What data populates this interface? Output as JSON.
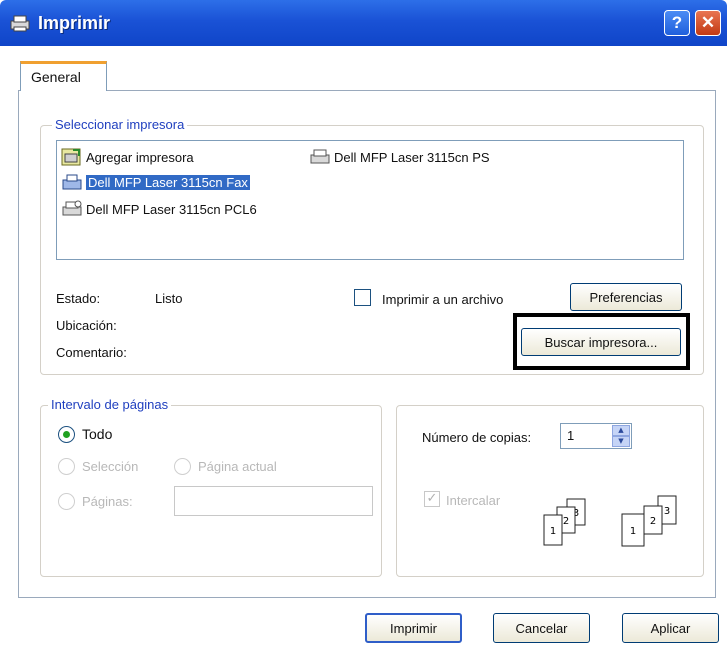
{
  "window": {
    "title": "Imprimir",
    "help_label": "?",
    "close_label": "✕"
  },
  "tabs": [
    {
      "label": "General"
    }
  ],
  "select_printer": {
    "legend": "Seleccionar impresora",
    "printers": [
      {
        "label": "Agregar impresora",
        "icon": "add-printer-icon"
      },
      {
        "label": "Dell MFP Laser 3115cn PS",
        "icon": "printer-icon"
      },
      {
        "label": "Dell MFP Laser 3115cn Fax",
        "icon": "fax-icon",
        "selected": true
      },
      {
        "label": "Dell MFP Laser 3115cn PCL6",
        "icon": "printer-icon"
      }
    ],
    "status_label": "Estado:",
    "status_value": "Listo",
    "location_label": "Ubicación:",
    "comment_label": "Comentario:",
    "print_to_file_label": "Imprimir a un archivo",
    "preferences_button": "Preferencias",
    "find_printer_button": "Buscar impresora..."
  },
  "page_range": {
    "legend": "Intervalo de páginas",
    "all_label": "Todo",
    "selection_label": "Selección",
    "current_page_label": "Página actual",
    "pages_label": "Páginas:",
    "pages_value": ""
  },
  "copies": {
    "label": "Número de copias:",
    "value": "1",
    "collate_label": "Intercalar",
    "collate_checked": true
  },
  "buttons": {
    "print": "Imprimir",
    "cancel": "Cancelar",
    "apply": "Aplicar"
  },
  "colors": {
    "titlebar": "#1a52d6",
    "legend": "#1f3fbf",
    "selection": "#316ac5",
    "close": "#c23a14"
  }
}
